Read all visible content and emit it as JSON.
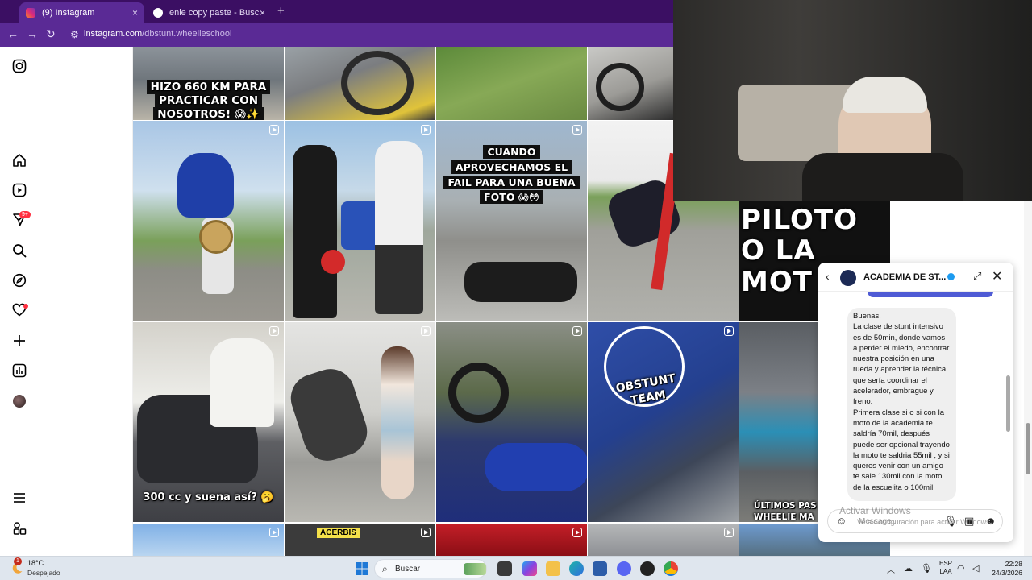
{
  "browser": {
    "tabs": [
      {
        "label": "(9) Instagram",
        "active": true
      },
      {
        "label": "enie copy paste - Buscar con G",
        "active": false
      }
    ],
    "new_tab": "+",
    "close_glyph": "×",
    "url_host": "instagram.com",
    "url_path": "/dbstunt.wheelieschool"
  },
  "nav": {
    "notification_badge": "9+",
    "icons": [
      "instagram-icon",
      "home-icon",
      "reels-icon",
      "messages-icon",
      "search-icon",
      "explore-icon",
      "heart-icon",
      "create-icon",
      "dashboard-icon",
      "profile-avatar",
      "menu-icon",
      "more-icon"
    ]
  },
  "posts": {
    "row0": [
      {
        "caption": "HIZO 660 KM PARA\nPRACTICAR CON\nNOSOTROS! 😱✨"
      },
      {
        "caption": ""
      },
      {
        "caption": ""
      },
      {
        "caption": ""
      }
    ],
    "row1": [
      {
        "caption": ""
      },
      {
        "caption": ""
      },
      {
        "caption": "CUANDO\nAPROVECHAMOS EL\nFAIL PARA UNA BUENA\nFOTO 😱😳"
      },
      {
        "caption": ""
      },
      {
        "caption": "PILOTO\nO LA\nMOT"
      }
    ],
    "row2": [
      {
        "caption": "300 cc y suena así? 🥱"
      },
      {
        "caption": ""
      },
      {
        "caption": ""
      },
      {
        "caption": "OBSTUNT\nTEAM"
      },
      {
        "caption": "ÚLTIMOS PAS\nWHEELIE MA"
      }
    ],
    "row3_caption": "ACERBIS"
  },
  "chat": {
    "name": "ACADEMIA DE ST...",
    "message": "Buenas!\nLa clase de stunt intensivo es de 50min, donde vamos a perder el miedo, encontrar nuestra posición en una rueda y aprender la técnica que sería coordinar el acelerador, embrague y freno.\nPrimera clase si o si con la moto de la academia te saldría 70mil, después puede ser opcional trayendo la moto te saldria 55mil , y si queres venir con un amigo te sale 130mil con la moto de la escuelita o 100mil",
    "input_placeholder": "Message...",
    "colors": {
      "verified": "#1d9bf0",
      "accent": "#4f5bd5"
    }
  },
  "watermark": {
    "line1": "Activar Windows",
    "line2": "Ve a Configuración para activar Windows."
  },
  "taskbar": {
    "weather_temp": "18°C",
    "weather_desc": "Despejado",
    "weather_badge": "1",
    "search_label": "Buscar",
    "lang_line1": "ESP",
    "lang_line2": "LAA",
    "time": "22:28",
    "date": "24/3/2026"
  }
}
